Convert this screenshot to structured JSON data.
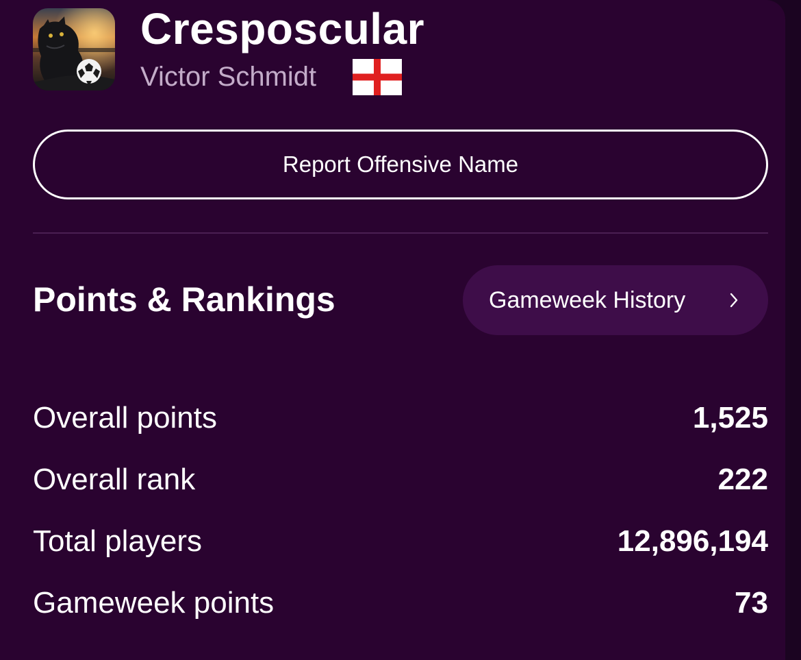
{
  "profile": {
    "team_name": "Cresposcular",
    "manager_name": "Victor Schmidt",
    "avatar_icon": "panther-with-football-avatar",
    "flag_icon": "england-flag-icon"
  },
  "actions": {
    "report_label": "Report Offensive Name"
  },
  "points_rankings": {
    "title": "Points & Rankings",
    "history_button_label": "Gameweek History",
    "history_button_icon": "chevron-right-icon",
    "stats": [
      {
        "label": "Overall points",
        "value": "1,525"
      },
      {
        "label": "Overall rank",
        "value": "222"
      },
      {
        "label": "Total players",
        "value": "12,896,194"
      },
      {
        "label": "Gameweek points",
        "value": "73"
      }
    ]
  },
  "colors": {
    "page_background": "#2a0330",
    "outer_background": "#1b0421",
    "secondary_text": "#c3acc9",
    "history_button_bg": "#3e0d49",
    "divider": "#4a1f52",
    "flag_red": "#e02020"
  }
}
